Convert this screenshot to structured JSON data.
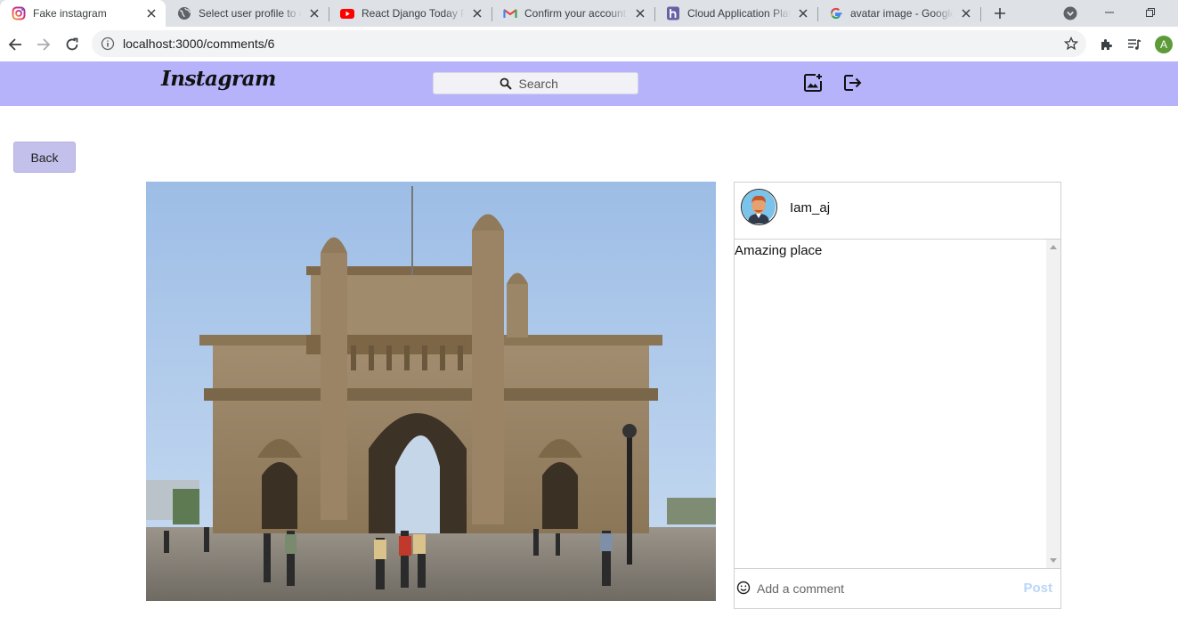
{
  "browser": {
    "tabs": [
      {
        "title": "Fake instagram",
        "icon": "instagram-icon",
        "active": true
      },
      {
        "title": "Select user profile to c",
        "icon": "globe-icon",
        "active": false
      },
      {
        "title": "React Django Today Pl",
        "icon": "youtube-icon",
        "active": false
      },
      {
        "title": "Confirm your account",
        "icon": "gmail-icon",
        "active": false
      },
      {
        "title": "Cloud Application Plat",
        "icon": "heroku-icon",
        "active": false
      },
      {
        "title": "avatar image - Google",
        "icon": "google-icon",
        "active": false
      }
    ],
    "url": "localhost:3000/comments/6",
    "profile_initial": "A",
    "profile_color": "#5d9b39"
  },
  "header": {
    "logo": "Instagram",
    "search_placeholder": "Search",
    "background": "#b6b3fb"
  },
  "page": {
    "back_label": "Back"
  },
  "post": {
    "image_subject": "gateway-of-india-photo",
    "username": "Iam_aj",
    "comments": [
      {
        "text": "Amazing place"
      }
    ],
    "comment_placeholder": "Add a comment",
    "post_label": "Post",
    "post_label_color": "#b9d6f7"
  }
}
